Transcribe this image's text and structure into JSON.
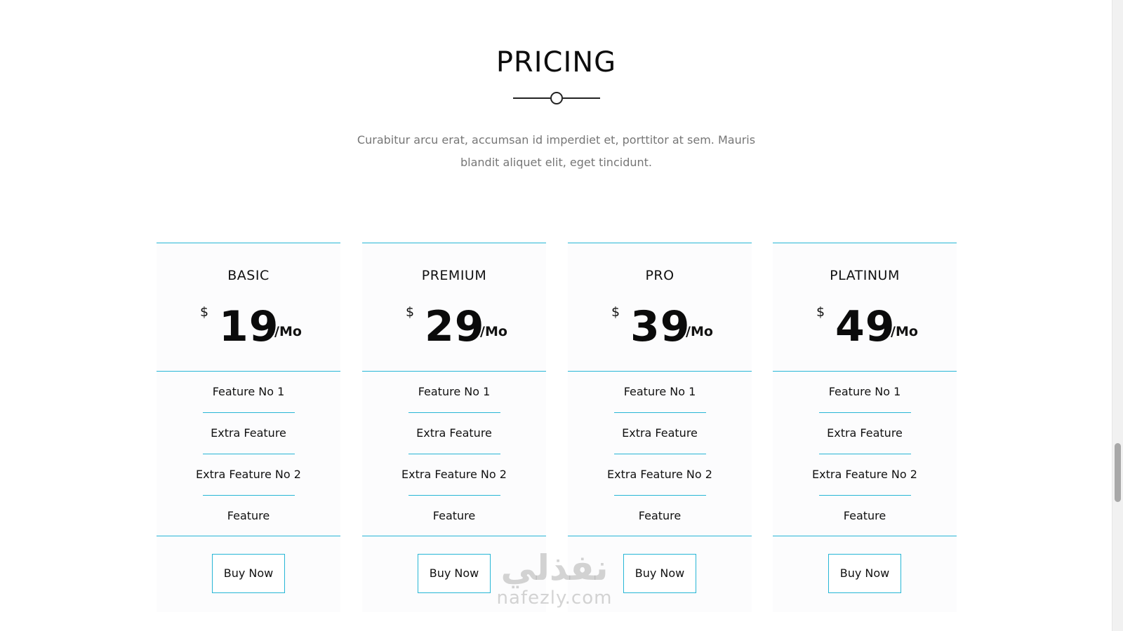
{
  "section": {
    "title": "PRICING",
    "description": "Curabitur arcu erat, accumsan id imperdiet et, porttitor at sem. Mauris blandit aliquet elit, eget tincidunt.",
    "divider_icon": "circle-divider-icon"
  },
  "plans": [
    {
      "name": "BASIC",
      "currency": "$",
      "amount": "19",
      "period": "/Mo",
      "features": [
        "Feature No 1",
        "Extra Feature",
        "Extra Feature No 2",
        "Feature"
      ],
      "button_label": "Buy Now"
    },
    {
      "name": "PREMIUM",
      "currency": "$",
      "amount": "29",
      "period": "/Mo",
      "features": [
        "Feature No 1",
        "Extra Feature",
        "Extra Feature No 2",
        "Feature"
      ],
      "button_label": "Buy Now"
    },
    {
      "name": "PRO",
      "currency": "$",
      "amount": "39",
      "period": "/Mo",
      "features": [
        "Feature No 1",
        "Extra Feature",
        "Extra Feature No 2",
        "Feature"
      ],
      "button_label": "Buy Now"
    },
    {
      "name": "PLATINUM",
      "currency": "$",
      "amount": "49",
      "period": "/Mo",
      "features": [
        "Feature No 1",
        "Extra Feature",
        "Extra Feature No 2",
        "Feature"
      ],
      "button_label": "Buy Now"
    }
  ],
  "watermark": {
    "arabic": "نفذلي",
    "latin": "nafezly.com"
  },
  "colors": {
    "accent": "#27b6d6",
    "text": "#111111",
    "muted": "#767676",
    "card_bg": "#fcfcfd"
  }
}
